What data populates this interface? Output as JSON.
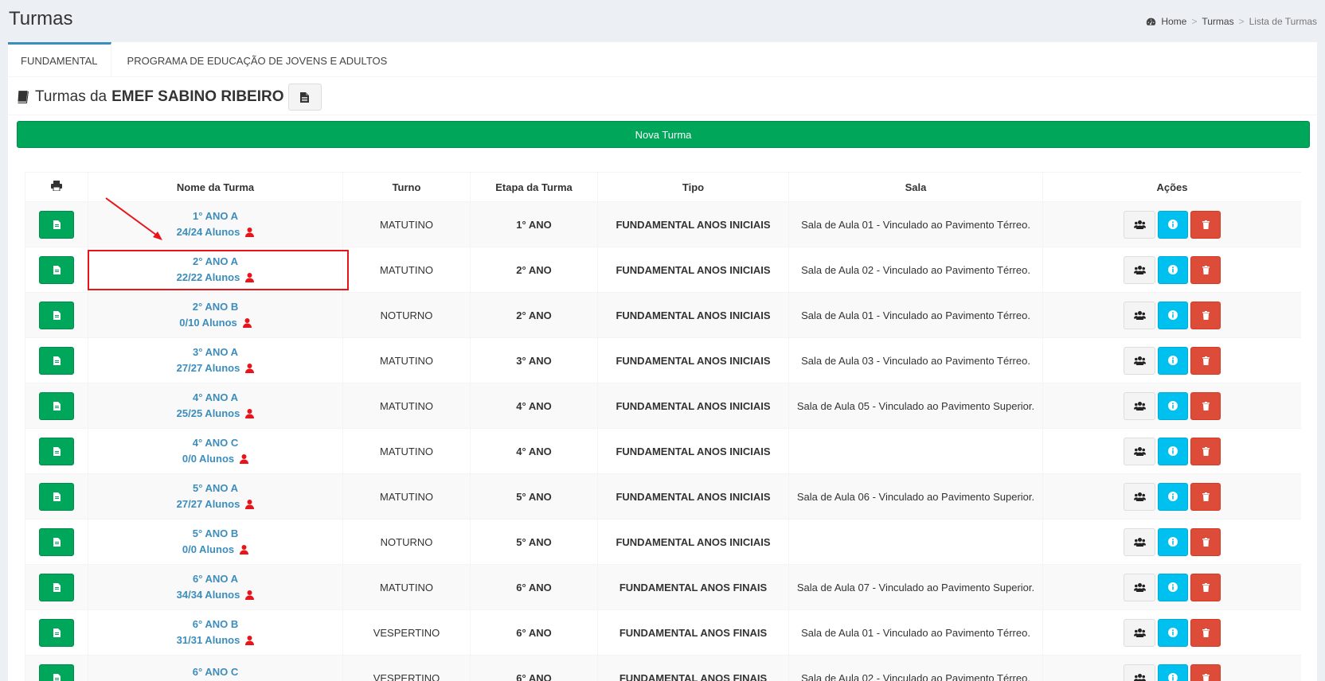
{
  "page": {
    "title": "Turmas",
    "breadcrumb": {
      "home": "Home",
      "sep": ">",
      "turmas": "Turmas",
      "current": "Lista de Turmas"
    }
  },
  "tabs": [
    {
      "label": "FUNDAMENTAL",
      "active": true
    },
    {
      "label": "PROGRAMA DE EDUCAÇÃO DE JOVENS E ADULTOS",
      "active": false
    }
  ],
  "section": {
    "prefix": "Turmas da",
    "school": "EMEF SABINO RIBEIRO"
  },
  "nova_turma_label": "Nova Turma",
  "table": {
    "headers": [
      "",
      "Nome da Turma",
      "Turno",
      "Etapa da Turma",
      "Tipo",
      "Sala",
      "Ações"
    ],
    "rows": [
      {
        "nome": "1° ANO A",
        "alunos": "24/24 Alunos",
        "turno": "MATUTINO",
        "etapa": "1° ANO",
        "tipo": "FUNDAMENTAL ANOS INICIAIS",
        "sala": "Sala de Aula 01 - Vinculado ao Pavimento Térreo."
      },
      {
        "nome": "2° ANO A",
        "alunos": "22/22 Alunos",
        "turno": "MATUTINO",
        "etapa": "2° ANO",
        "tipo": "FUNDAMENTAL ANOS INICIAIS",
        "sala": "Sala de Aula 02 - Vinculado ao Pavimento Térreo."
      },
      {
        "nome": "2° ANO B",
        "alunos": "0/10 Alunos",
        "turno": "NOTURNO",
        "etapa": "2° ANO",
        "tipo": "FUNDAMENTAL ANOS INICIAIS",
        "sala": "Sala de Aula 01 - Vinculado ao Pavimento Térreo."
      },
      {
        "nome": "3° ANO A",
        "alunos": "27/27 Alunos",
        "turno": "MATUTINO",
        "etapa": "3° ANO",
        "tipo": "FUNDAMENTAL ANOS INICIAIS",
        "sala": "Sala de Aula 03 - Vinculado ao Pavimento Térreo."
      },
      {
        "nome": "4° ANO A",
        "alunos": "25/25 Alunos",
        "turno": "MATUTINO",
        "etapa": "4° ANO",
        "tipo": "FUNDAMENTAL ANOS INICIAIS",
        "sala": "Sala de Aula 05 - Vinculado ao Pavimento Superior."
      },
      {
        "nome": "4° ANO C",
        "alunos": "0/0 Alunos",
        "turno": "MATUTINO",
        "etapa": "4° ANO",
        "tipo": "FUNDAMENTAL ANOS INICIAIS",
        "sala": ""
      },
      {
        "nome": "5° ANO A",
        "alunos": "27/27 Alunos",
        "turno": "MATUTINO",
        "etapa": "5° ANO",
        "tipo": "FUNDAMENTAL ANOS INICIAIS",
        "sala": "Sala de Aula 06 - Vinculado ao Pavimento Superior."
      },
      {
        "nome": "5° ANO B",
        "alunos": "0/0 Alunos",
        "turno": "NOTURNO",
        "etapa": "5° ANO",
        "tipo": "FUNDAMENTAL ANOS INICIAIS",
        "sala": ""
      },
      {
        "nome": "6° ANO A",
        "alunos": "34/34 Alunos",
        "turno": "MATUTINO",
        "etapa": "6° ANO",
        "tipo": "FUNDAMENTAL ANOS FINAIS",
        "sala": "Sala de Aula 07 - Vinculado ao Pavimento Superior."
      },
      {
        "nome": "6° ANO B",
        "alunos": "31/31 Alunos",
        "turno": "VESPERTINO",
        "etapa": "6° ANO",
        "tipo": "FUNDAMENTAL ANOS FINAIS",
        "sala": "Sala de Aula 01 - Vinculado ao Pavimento Térreo."
      },
      {
        "nome": "6° ANO C",
        "alunos": "",
        "turno": "VESPERTINO",
        "etapa": "6° ANO",
        "tipo": "FUNDAMENTAL ANOS FINAIS",
        "sala": "Sala de Aula 02 - Vinculado ao Pavimento Térreo."
      }
    ]
  },
  "icons": {
    "print": "print-icon",
    "report": "file-text-icon",
    "students": "users-icon",
    "info": "info-icon",
    "delete": "trash-icon",
    "user": "user-icon",
    "book": "book-icon",
    "home": "dashboard-icon"
  },
  "colors": {
    "success": "#00a65a",
    "info": "#00c0ef",
    "danger": "#dd4b39",
    "link": "#3c8dbc",
    "user_icon": "#e8141a",
    "annotation": "#e8141a"
  }
}
